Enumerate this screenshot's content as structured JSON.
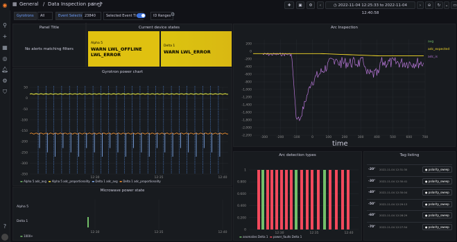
{
  "breadcrumb": {
    "folder": "General",
    "separator": "/",
    "title": "Data Inspection panel"
  },
  "time_range": "2022-11-04 12:25:33 to 2022-11-04 12:40:58",
  "variables": {
    "gyrotrons_label": "Gyrotrons",
    "gyrotrons_value": "All",
    "event_label": "Event Selection",
    "event_value": "23840",
    "selected_time_label": "Selected Event Time",
    "ranges_label": "ID Ranges"
  },
  "panels": {
    "alerts": {
      "title": "Panel Title",
      "empty_text": "No alerts matching filters"
    },
    "device_states": {
      "title": "Current device states",
      "cards": [
        {
          "name": "Alpha 5",
          "value": "WARN LWL_OFFLINE LWL_ERROR",
          "color": "#e0c110"
        },
        {
          "name": "Delta 1",
          "value": "WARN LWL_ERROR",
          "color": "#e0c110"
        }
      ]
    },
    "gyrotron": {
      "title": "Gyrotron power chart",
      "y_ticks": [
        "50",
        "0",
        "-50",
        "-100",
        "-150",
        "-200",
        "-250",
        "-300",
        "-350"
      ],
      "x_ticks": [
        "12:30",
        "12:35",
        "12:40"
      ],
      "legend": [
        "Alpha 5 adc_avg",
        "Alpha 5 adc_proportionality",
        "Delta 1 adc_avg",
        "Delta 1 adc_proportionality"
      ]
    },
    "arc": {
      "title": "Arc Inspection",
      "y_ticks": [
        "200",
        "0",
        "-200",
        "-400",
        "-600",
        "-800",
        "-1,000",
        "-1,200",
        "-1,400",
        "-1,600",
        "-1,800",
        "-2,000",
        "-2,200"
      ],
      "x_ticks": [
        "-300",
        "-200",
        "-100",
        "0",
        "100",
        "200",
        "300",
        "400",
        "500",
        "600",
        "700"
      ],
      "xlabel": "time",
      "legend": [
        "avg",
        "adc_expected",
        "adc_is"
      ]
    },
    "microwave": {
      "title": "Microwave power state",
      "rows": [
        "Alpha 5",
        "Delta 1"
      ],
      "x_ticks": [
        "12:30",
        "12:35",
        "12:40"
      ],
      "legend": "1000+"
    },
    "arc_types": {
      "title": "Arc detection types",
      "y_ticks": [
        "1",
        "0.800",
        "0.600",
        "0.400",
        "0.200",
        "0"
      ],
      "x_ticks": [
        "12:30",
        "12:35",
        "12:40"
      ],
      "legend": [
        "anomalies Delta 1",
        "power_faults Delta 1"
      ]
    },
    "tags": {
      "title": "Tag listing",
      "rows": [
        {
          "value": "-20°",
          "time": "2022-11-04 12:31:30",
          "tag": "polarity_sweep"
        },
        {
          "value": "-30°",
          "time": "2022-11-04 12:30:41",
          "tag": "polarity_sweep"
        },
        {
          "value": "-40°",
          "time": "2022-11-04 12:30:04",
          "tag": "polarity_sweep"
        },
        {
          "value": "-50°",
          "time": "2022-11-04 12:29:13",
          "tag": "polarity_sweep"
        },
        {
          "value": "-60°",
          "time": "2022-11-04 12:28:29",
          "tag": "polarity_sweep"
        },
        {
          "value": "-70°",
          "time": "2022-11-04 12:27:54",
          "tag": "polarity_sweep"
        }
      ]
    }
  },
  "colors": {
    "accent": "#6e9fff",
    "green": "#73bf69",
    "yellow": "#fade2a",
    "orange": "#ff9830",
    "blue": "#8ab8ff",
    "purple": "#b877d9",
    "red": "#f2495c"
  },
  "icons": [
    "grafana-logo-icon",
    "search-icon",
    "plus-icon",
    "dashboards-icon",
    "explore-icon",
    "alerting-icon",
    "settings-icon",
    "shield-icon"
  ]
}
